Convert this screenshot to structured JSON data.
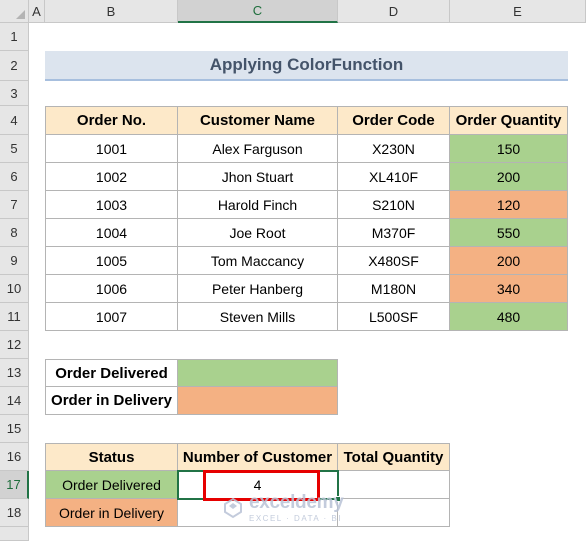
{
  "columns": [
    "A",
    "B",
    "C",
    "D",
    "E"
  ],
  "rows": [
    "1",
    "2",
    "3",
    "4",
    "5",
    "6",
    "7",
    "8",
    "9",
    "10",
    "11",
    "12",
    "13",
    "14",
    "15",
    "16",
    "17",
    "18"
  ],
  "title": "Applying ColorFunction",
  "orders": {
    "headers": [
      "Order No.",
      "Customer Name",
      "Order Code",
      "Order Quantity"
    ],
    "rows": [
      {
        "no": "1001",
        "name": "Alex Farguson",
        "code": "X230N",
        "qty": "150",
        "status": "delivered"
      },
      {
        "no": "1002",
        "name": "Jhon Stuart",
        "code": "XL410F",
        "qty": "200",
        "status": "delivered"
      },
      {
        "no": "1003",
        "name": "Harold Finch",
        "code": "S210N",
        "qty": "120",
        "status": "in-delivery"
      },
      {
        "no": "1004",
        "name": "Joe Root",
        "code": "M370F",
        "qty": "550",
        "status": "delivered"
      },
      {
        "no": "1005",
        "name": "Tom Maccancy",
        "code": "X480SF",
        "qty": "200",
        "status": "in-delivery"
      },
      {
        "no": "1006",
        "name": "Peter Hanberg",
        "code": "M180N",
        "qty": "340",
        "status": "in-delivery"
      },
      {
        "no": "1007",
        "name": "Steven Mills",
        "code": "L500SF",
        "qty": "480",
        "status": "delivered"
      }
    ]
  },
  "legend": {
    "delivered": "Order Delivered",
    "in_delivery": "Order in Delivery"
  },
  "summary": {
    "headers": [
      "Status",
      "Number of Customer",
      "Total Quantity"
    ],
    "row1_status": "Order Delivered",
    "row1_count": "4",
    "row1_total": "",
    "row2_status": "Order in Delivery",
    "row2_count": "",
    "row2_total": ""
  },
  "colors": {
    "delivered": "#a9d18e",
    "in_delivery": "#f4b183",
    "header_fill": "#fde9c9",
    "selection": "#e60000"
  },
  "watermark": {
    "brand": "exceldemy",
    "tagline": "EXCEL · DATA · BI"
  },
  "active_cell": "C17"
}
